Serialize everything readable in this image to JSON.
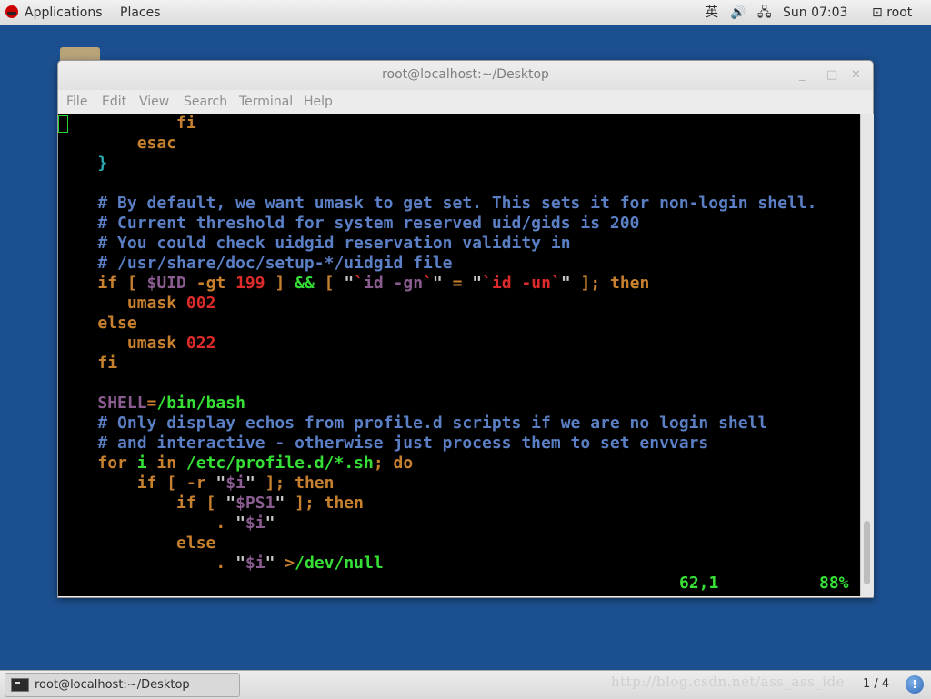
{
  "top_panel": {
    "applications": "Applications",
    "places": "Places",
    "input_method": "英",
    "volume_icon": "🔊",
    "network_icon": "🖧",
    "clock": "Sun 07:03",
    "user": "root",
    "user_icon": "⊡"
  },
  "window": {
    "title": "root@localhost:~/Desktop",
    "minimize": "_",
    "maximize": "□",
    "close": "✕"
  },
  "menubar": [
    "File",
    "Edit",
    "View",
    "Search",
    "Terminal",
    "Help"
  ],
  "terminal": {
    "lines": [
      [
        [
          "            ",
          "wt"
        ],
        [
          "fi",
          "kw"
        ]
      ],
      [
        [
          "        ",
          "wt"
        ],
        [
          "esac",
          "kw"
        ]
      ],
      [
        [
          "    ",
          "wt"
        ],
        [
          "}",
          "cy"
        ]
      ],
      [],
      [
        [
          "    ",
          "wt"
        ],
        [
          "# By default, we want umask to get set. This sets it for non-login shell.",
          "cm"
        ]
      ],
      [
        [
          "    ",
          "wt"
        ],
        [
          "# Current threshold for system reserved uid/gids is 200",
          "cm"
        ]
      ],
      [
        [
          "    ",
          "wt"
        ],
        [
          "# You could check uidgid reservation validity in",
          "cm"
        ]
      ],
      [
        [
          "    ",
          "wt"
        ],
        [
          "# /usr/share/doc/setup-*/uidgid file",
          "cm"
        ]
      ],
      [
        [
          "    ",
          "wt"
        ],
        [
          "if [ ",
          "kw"
        ],
        [
          "$UID",
          "va"
        ],
        [
          " -gt ",
          "kw"
        ],
        [
          "199",
          "st"
        ],
        [
          " ] ",
          "kw"
        ],
        [
          "&&",
          "gr"
        ],
        [
          " [ ",
          "kw"
        ],
        [
          "\"",
          "wt"
        ],
        [
          "`",
          "st"
        ],
        [
          "id -gn",
          "va"
        ],
        [
          "`",
          "st"
        ],
        [
          "\"",
          "wt"
        ],
        [
          " = ",
          "kw"
        ],
        [
          "\"",
          "wt"
        ],
        [
          "`",
          "st"
        ],
        [
          "id -un",
          "st"
        ],
        [
          "`",
          "st"
        ],
        [
          "\"",
          "wt"
        ],
        [
          " ]; then",
          "kw"
        ]
      ],
      [
        [
          "       ",
          "wt"
        ],
        [
          "umask ",
          "kw"
        ],
        [
          "002",
          "st"
        ]
      ],
      [
        [
          "    ",
          "wt"
        ],
        [
          "else",
          "kw"
        ]
      ],
      [
        [
          "       ",
          "wt"
        ],
        [
          "umask ",
          "kw"
        ],
        [
          "022",
          "st"
        ]
      ],
      [
        [
          "    ",
          "wt"
        ],
        [
          "fi",
          "kw"
        ]
      ],
      [],
      [
        [
          "    ",
          "wt"
        ],
        [
          "SHELL",
          "va"
        ],
        [
          "=",
          "kw"
        ],
        [
          "/bin/bash",
          "gr"
        ]
      ],
      [
        [
          "    ",
          "wt"
        ],
        [
          "# Only display echos from profile.d scripts if we are no login shell",
          "cm"
        ]
      ],
      [
        [
          "    ",
          "wt"
        ],
        [
          "# and interactive - otherwise just process them to set envvars",
          "cm"
        ]
      ],
      [
        [
          "    ",
          "wt"
        ],
        [
          "for ",
          "kw"
        ],
        [
          "i ",
          "gr"
        ],
        [
          "in ",
          "kw"
        ],
        [
          "/etc/profile.d/*.sh",
          "gr"
        ],
        [
          "; ",
          "kw"
        ],
        [
          "do",
          "kw"
        ]
      ],
      [
        [
          "        ",
          "wt"
        ],
        [
          "if [ -r ",
          "kw"
        ],
        [
          "\"",
          "wt"
        ],
        [
          "$i",
          "va"
        ],
        [
          "\"",
          "wt"
        ],
        [
          " ]; then",
          "kw"
        ]
      ],
      [
        [
          "            ",
          "wt"
        ],
        [
          "if [ ",
          "kw"
        ],
        [
          "\"",
          "wt"
        ],
        [
          "$PS1",
          "va"
        ],
        [
          "\"",
          "wt"
        ],
        [
          " ]; then",
          "kw"
        ]
      ],
      [
        [
          "                ",
          "wt"
        ],
        [
          ". ",
          "kw"
        ],
        [
          "\"",
          "wt"
        ],
        [
          "$i",
          "va"
        ],
        [
          "\"",
          "wt"
        ]
      ],
      [
        [
          "            ",
          "wt"
        ],
        [
          "else",
          "kw"
        ]
      ],
      [
        [
          "                ",
          "wt"
        ],
        [
          ". ",
          "kw"
        ],
        [
          "\"",
          "wt"
        ],
        [
          "$i",
          "va"
        ],
        [
          "\"",
          "wt"
        ],
        [
          " ",
          "wt"
        ],
        [
          ">",
          "kw"
        ],
        [
          "/dev/null",
          "gr"
        ]
      ]
    ],
    "status_position": "62,1",
    "status_percent": "88%"
  },
  "bottom_panel": {
    "taskbar_label": "root@localhost:~/Desktop",
    "watermark": "http://blog.csdn.net/ass_ass_ide",
    "workspace": "1 / 4",
    "notification": "!"
  }
}
